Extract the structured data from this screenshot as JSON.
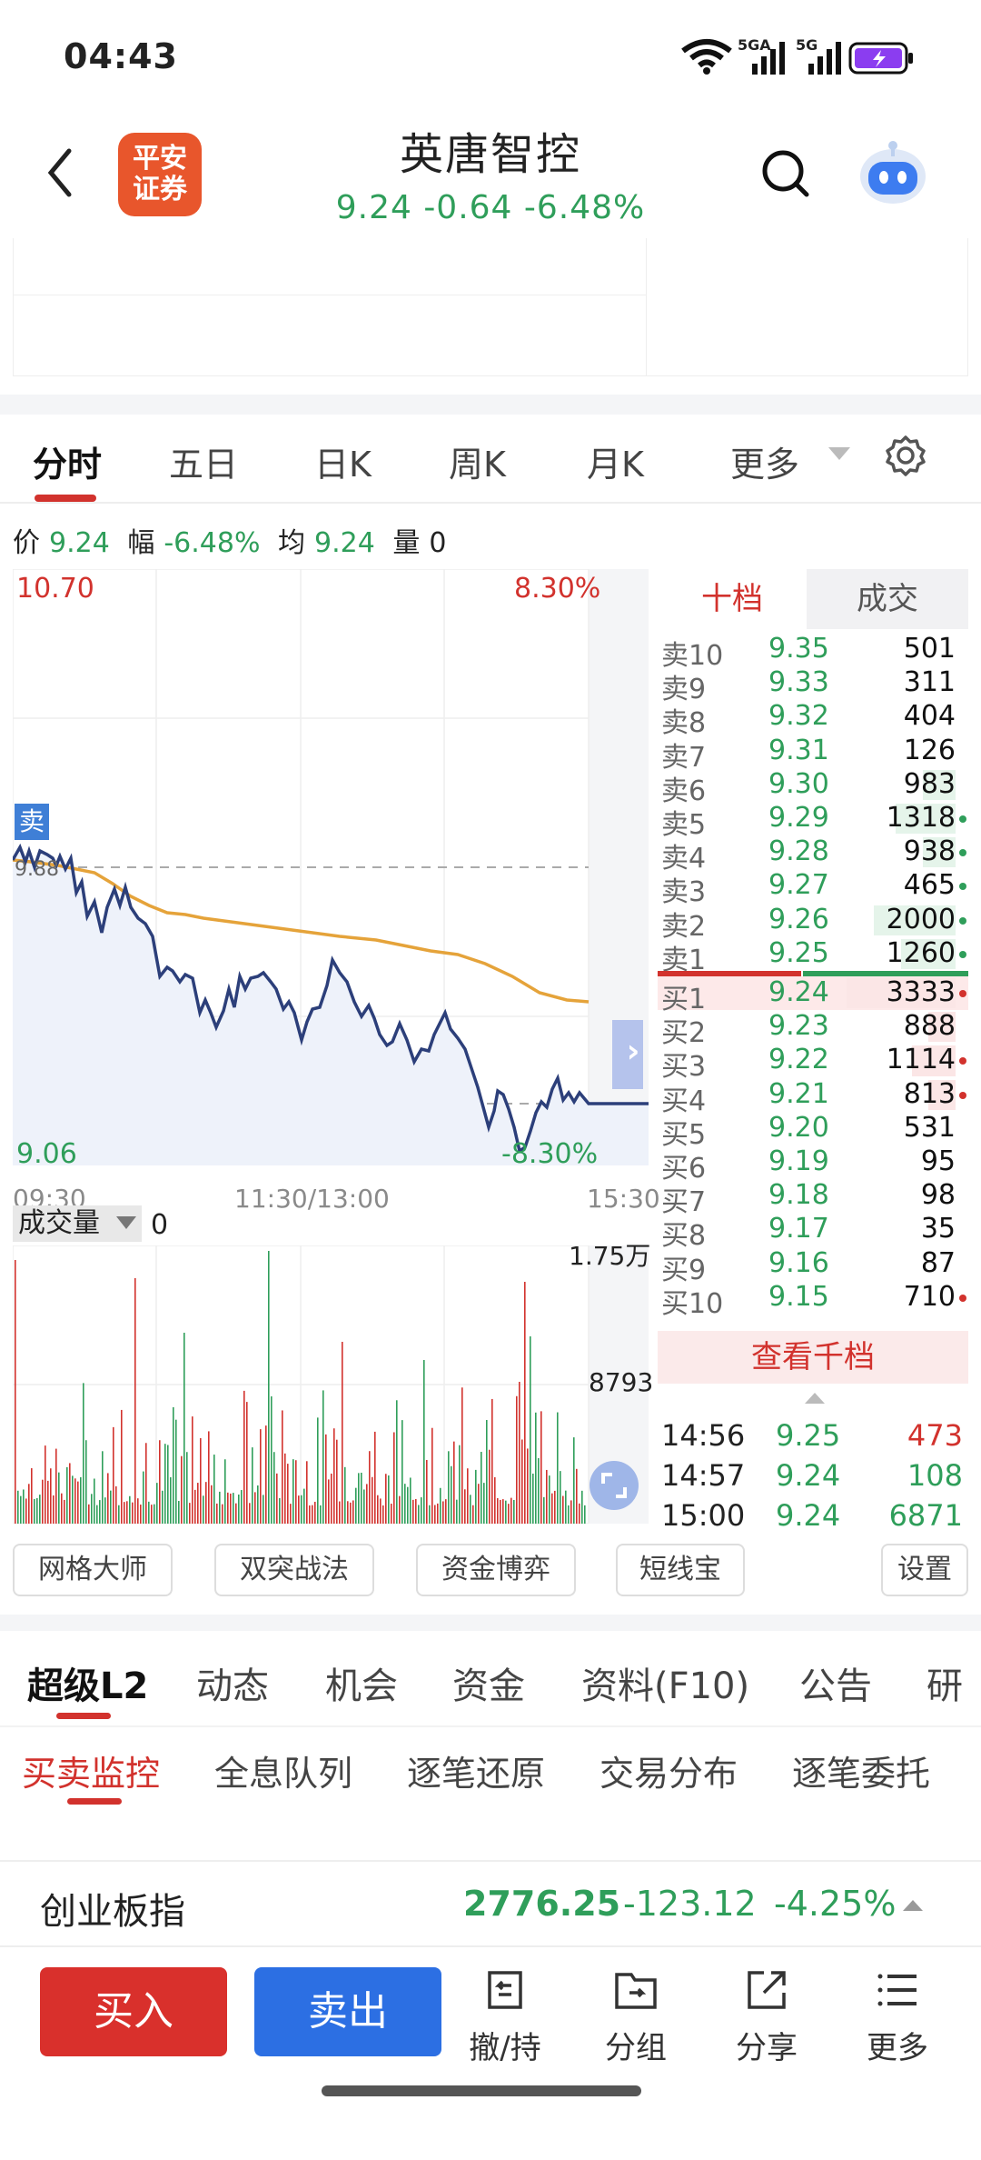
{
  "status": {
    "time": "04:43",
    "sig1": "5GA",
    "sig2": "5G"
  },
  "header": {
    "broker_logo": [
      "平安",
      "证券"
    ],
    "stock_name": "英唐智控",
    "quote": "9.24  -0.64  -6.48%"
  },
  "period_tabs": [
    "分时",
    "五日",
    "日K",
    "周K",
    "月K",
    "更多"
  ],
  "price_info": {
    "price_label": "价",
    "price": "9.24",
    "change_label": "幅",
    "change": "-6.48%",
    "avg_label": "均",
    "avg": "9.24",
    "vol_label": "量",
    "vol": "0"
  },
  "chart": {
    "y_top": "10.70",
    "y_top_pct": "8.30%",
    "y_bottom": "9.06",
    "y_bottom_pct": "-8.30%",
    "prev_close_label": "9.88",
    "sell_marker": "卖",
    "x_start": "09:30",
    "x_mid": "11:30/13:00",
    "x_end": "15:30",
    "expand_arrow": "›"
  },
  "volume": {
    "selector": "成交量",
    "value": "0",
    "top_label": "1.75万",
    "mid_label": "8793"
  },
  "orderbook": {
    "tabs": [
      "十档",
      "成交"
    ],
    "sell": [
      {
        "label": "卖10",
        "price": "9.35",
        "qty": "501",
        "bar": 0,
        "dot": false
      },
      {
        "label": "卖9",
        "price": "9.33",
        "qty": "311",
        "bar": 0,
        "dot": false
      },
      {
        "label": "卖8",
        "price": "9.32",
        "qty": "404",
        "bar": 0,
        "dot": false
      },
      {
        "label": "卖7",
        "price": "9.31",
        "qty": "126",
        "bar": 0,
        "dot": false
      },
      {
        "label": "卖6",
        "price": "9.30",
        "qty": "983",
        "bar": 0.3,
        "dot": false
      },
      {
        "label": "卖5",
        "price": "9.29",
        "qty": "1318",
        "bar": 0.55,
        "dot": true
      },
      {
        "label": "卖4",
        "price": "9.28",
        "qty": "938",
        "bar": 0.3,
        "dot": true
      },
      {
        "label": "卖3",
        "price": "9.27",
        "qty": "465",
        "bar": 0,
        "dot": true
      },
      {
        "label": "卖2",
        "price": "9.26",
        "qty": "2000",
        "bar": 0.75,
        "dot": true
      },
      {
        "label": "卖1",
        "price": "9.25",
        "qty": "1260",
        "bar": 0.5,
        "dot": true
      }
    ],
    "buy": [
      {
        "label": "买1",
        "price": "9.24",
        "qty": "3333",
        "bar": 1.0,
        "dot": true
      },
      {
        "label": "买2",
        "price": "9.23",
        "qty": "888",
        "bar": 0.25,
        "dot": false
      },
      {
        "label": "买3",
        "price": "9.22",
        "qty": "1114",
        "bar": 0.4,
        "dot": true
      },
      {
        "label": "买4",
        "price": "9.21",
        "qty": "813",
        "bar": 0.25,
        "dot": true
      },
      {
        "label": "买5",
        "price": "9.20",
        "qty": "531",
        "bar": 0,
        "dot": false
      },
      {
        "label": "买6",
        "price": "9.19",
        "qty": "95",
        "bar": 0,
        "dot": false
      },
      {
        "label": "买7",
        "price": "9.18",
        "qty": "98",
        "bar": 0,
        "dot": false
      },
      {
        "label": "买8",
        "price": "9.17",
        "qty": "35",
        "bar": 0,
        "dot": false
      },
      {
        "label": "买9",
        "price": "9.16",
        "qty": "87",
        "bar": 0,
        "dot": false
      },
      {
        "label": "买10",
        "price": "9.15",
        "qty": "710",
        "bar": 0,
        "dot": true
      }
    ],
    "view_more": "查看千档",
    "trades": [
      {
        "time": "14:56",
        "price": "9.25",
        "qty": "473",
        "color": "#d2322d"
      },
      {
        "time": "14:57",
        "price": "9.24",
        "qty": "108",
        "color": "#2f9e5a"
      },
      {
        "time": "15:00",
        "price": "9.24",
        "qty": "6871",
        "color": "#2f9e5a"
      }
    ]
  },
  "tools": [
    "网格大师",
    "双突战法",
    "资金博弈",
    "短线宝",
    "设置"
  ],
  "l2_tabs": [
    "超级L2",
    "动态",
    "机会",
    "资金",
    "资料(F10)",
    "公告",
    "研"
  ],
  "sub_tabs": [
    "买卖监控",
    "全息队列",
    "逐笔还原",
    "交易分布",
    "逐笔委托"
  ],
  "index_row": {
    "name": "创业板指",
    "value": "2776.25",
    "change": "-123.12",
    "pct": "-4.25%"
  },
  "bottom_bar": {
    "buy": "买入",
    "sell": "卖出",
    "items": [
      "撤/持",
      "分组",
      "分享",
      "更多"
    ]
  },
  "colors": {
    "up": "#d2322d",
    "down": "#2f9e5a",
    "price_line": "#2c3f7a",
    "avg_line": "#e5a33a",
    "buy_btn": "#d9302c",
    "sell_btn": "#2c6fe3"
  }
}
